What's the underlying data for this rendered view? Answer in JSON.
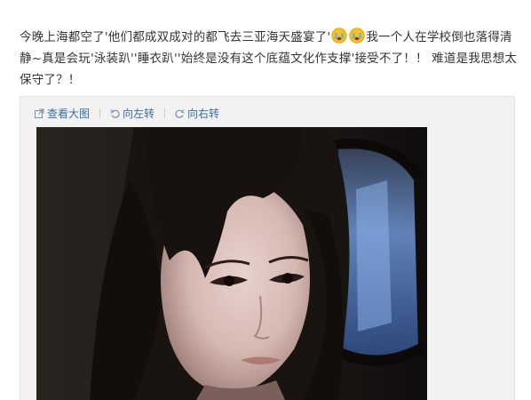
{
  "post": {
    "text_part1": "今晚上海都空了'他们都成双成对的都飞去三亚海天盛宴了'",
    "emoticons": [
      "crying-face-icon",
      "crying-face-icon"
    ],
    "text_part2": "我一个人在学校倒也落得清静~真是会玩'泳装趴''睡衣趴''始终是没有这个底蕴文化作支撑'接受不了！！ 难道是我思想太保守了？！"
  },
  "toolbar": {
    "view_large": "查看大图",
    "rotate_left": "向左转",
    "rotate_right": "向右转"
  },
  "colors": {
    "link": "#3a6ea5",
    "text": "#333333",
    "media_bg": "#f2f2f2"
  }
}
